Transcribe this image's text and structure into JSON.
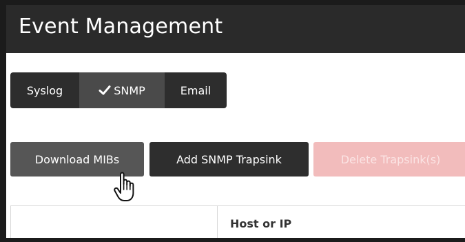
{
  "header": {
    "title": "Event Management"
  },
  "tabs": [
    {
      "label": "Syslog",
      "active": false
    },
    {
      "label": "SNMP",
      "active": true,
      "icon": "check-icon"
    },
    {
      "label": "Email",
      "active": false
    }
  ],
  "actions": {
    "download_label": "Download MIBs",
    "add_label": "Add SNMP Trapsink",
    "delete_label": "Delete Trapsink(s)",
    "delete_disabled": true
  },
  "table": {
    "columns": [
      "",
      "Host or IP"
    ]
  },
  "colors": {
    "header_bg": "#2a2a2a",
    "tab_bg": "#2d2d2d",
    "tab_active_bg": "#4a4a4a",
    "button_dark": "#2e2e2e",
    "button_hover": "#565656",
    "danger_disabled": "#f2bcbc"
  }
}
